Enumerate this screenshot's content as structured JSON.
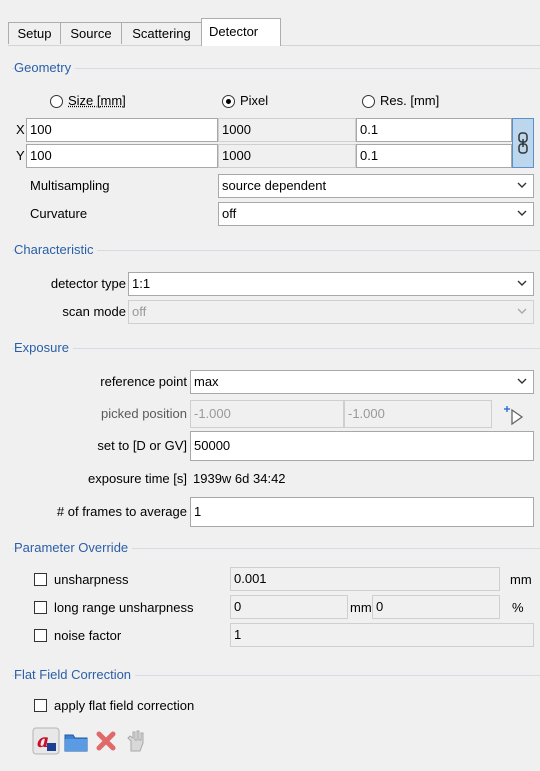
{
  "tabs": [
    {
      "label": "Setup",
      "active": false
    },
    {
      "label": "Source",
      "active": false
    },
    {
      "label": "Scattering",
      "active": false
    },
    {
      "label": "Detector",
      "active": true
    }
  ],
  "geometry": {
    "title": "Geometry",
    "radios": {
      "size": "Size [mm]",
      "pixel": "Pixel",
      "res": "Res. [mm]",
      "selected": "pixel"
    },
    "x_label": "X",
    "y_label": "Y",
    "x": {
      "size": "100",
      "pixel": "1000",
      "res": "0.1"
    },
    "y": {
      "size": "100",
      "pixel": "1000",
      "res": "0.1"
    },
    "multisampling_label": "Multisampling",
    "multisampling_value": "source dependent",
    "curvature_label": "Curvature",
    "curvature_value": "off",
    "link_icon": "chain-link-icon"
  },
  "characteristic": {
    "title": "Characteristic",
    "detector_type_label": "detector type",
    "detector_type_value": "1:1",
    "scan_mode_label": "scan mode",
    "scan_mode_value": "off"
  },
  "exposure": {
    "title": "Exposure",
    "reference_point_label": "reference point",
    "reference_point_value": "max",
    "picked_position_label": "picked position",
    "picked_x": "-1.000",
    "picked_y": "-1.000",
    "set_to_label": "set to [D or GV]",
    "set_to_value": "50000",
    "exposure_time_label": "exposure time [s]",
    "exposure_time_value": "1939w 6d 34:42",
    "frames_label": "# of frames to average",
    "frames_value": "1",
    "pick_icon": "pick-cursor-icon"
  },
  "override": {
    "title": "Parameter Override",
    "unsharpness_label": "unsharpness",
    "unsharpness_value": "0.001",
    "unsharpness_unit": "mm",
    "lr_label": "long range unsharpness",
    "lr_value1": "0",
    "lr_unit1": "mm",
    "lr_value2": "0",
    "lr_unit2": "%",
    "noise_label": "noise factor",
    "noise_value": "1"
  },
  "flatfield": {
    "title": "Flat Field Correction",
    "apply_label": "apply flat field correction",
    "tools": [
      "auto-image-icon",
      "open-folder-icon",
      "delete-icon",
      "hand-tool-icon"
    ]
  },
  "colors": {
    "group_title": "#2a5fa8"
  }
}
